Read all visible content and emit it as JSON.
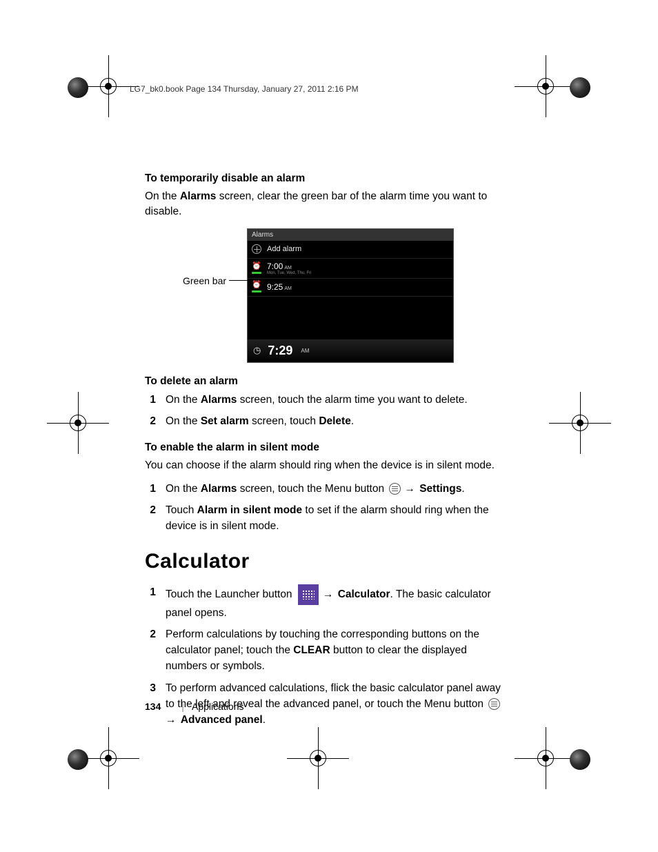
{
  "header": "LG7_bk0.book  Page 134  Thursday, January 27, 2011  2:16 PM",
  "s1": {
    "heading": "To temporarily disable an alarm",
    "p_a": "On the ",
    "p_b": "Alarms",
    "p_c": " screen, clear the green bar of the alarm time you want to disable."
  },
  "callout": "Green bar",
  "phone": {
    "title": "Alarms",
    "add": "Add alarm",
    "a1_time": "7:00",
    "a1_am": "AM",
    "a1_days": "Mon, Tue, Wed, Thu, Fri",
    "a2_time": "9:25",
    "a2_am": "AM",
    "foot_time": "7:29",
    "foot_am": "AM"
  },
  "s2": {
    "heading": "To delete an alarm",
    "steps": [
      {
        "n": "1",
        "a": "On the ",
        "b": "Alarms",
        "c": " screen, touch the alarm time you want to delete."
      },
      {
        "n": "2",
        "a": "On the ",
        "b": "Set alarm",
        "c": " screen, touch ",
        "d": "Delete",
        "e": "."
      }
    ]
  },
  "s3": {
    "heading": "To enable the alarm in silent mode",
    "p": "You can choose if the alarm should ring when the device is in silent mode.",
    "steps": [
      {
        "n": "1",
        "a": "On the ",
        "b": "Alarms",
        "c": " screen, touch the Menu button ",
        "arr": "→ ",
        "d": "Settings",
        "e": "."
      },
      {
        "n": "2",
        "a": "Touch ",
        "b": "Alarm in silent mode",
        "c": " to set if the alarm should ring when the device is in silent mode."
      }
    ]
  },
  "calc": {
    "title": "Calculator",
    "steps": [
      {
        "n": "1",
        "a": "Touch the Launcher button ",
        "arr": "→ ",
        "b": "Calculator",
        "c": ". The basic calculator panel opens."
      },
      {
        "n": "2",
        "a": "Perform calculations by touching the corresponding buttons on the calculator panel; touch the ",
        "b": "CLEAR",
        "c": " button to clear the displayed numbers or symbols."
      },
      {
        "n": "3",
        "a": "To perform advanced calculations, flick the basic calculator panel away to the left and reveal the advanced panel, or touch the Menu button ",
        "arr": " → ",
        "b": "Advanced panel",
        "c": "."
      }
    ]
  },
  "footer": {
    "page": "134",
    "section": "Applications"
  }
}
